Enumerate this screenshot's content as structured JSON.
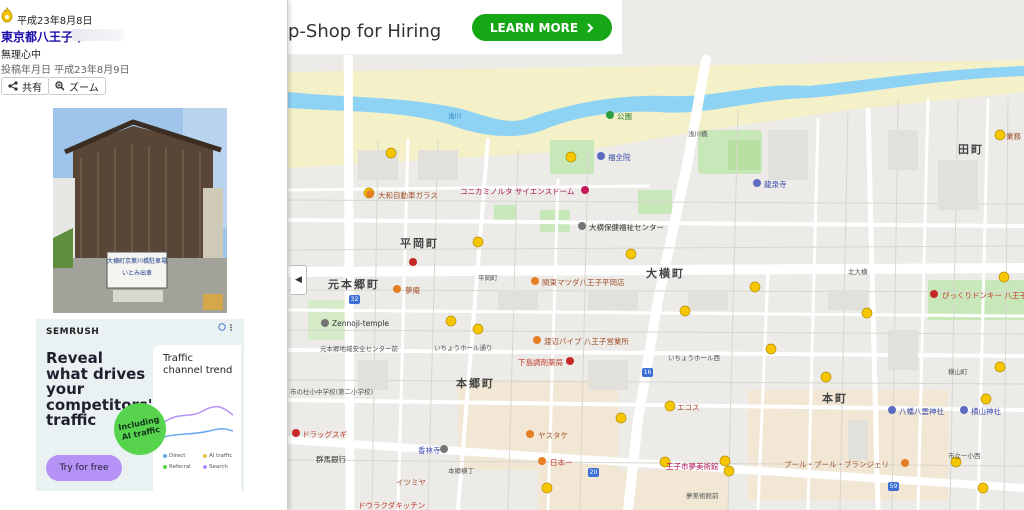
{
  "panel": {
    "date_top": "平成23年8月8日",
    "place_title": "東京都八王子市:",
    "place_note": "無理心中",
    "post_dates": "投稿年月日 平成23年8月9日",
    "share_label": "共有",
    "zoom_label": "ズーム",
    "photo_sign": "大横町京葉川橋駐車場",
    "photo_sign_sub": "いとみ出車"
  },
  "side_ad": {
    "brand": "SEMRUSH",
    "headline": "Reveal what drives your competitors' traffic",
    "card_title": "Traffic channel trend",
    "badge": "Including AI traffic",
    "cta": "Try for free",
    "legend": [
      "Direct",
      "AI traffic",
      "Referral",
      "Search"
    ]
  },
  "top_ad": {
    "text": "p-Shop for Hiring",
    "button": "LEARN MORE"
  },
  "map": {
    "river": "浅川",
    "districts": [
      "平岡町",
      "元本郷町",
      "大横町",
      "本郷町",
      "本町",
      "田町"
    ],
    "pois": {
      "park": "公園",
      "fukuzen": "福全院",
      "ryusenji": "龍泉寺",
      "konica": "コニカミノルタ サイエンスドーム",
      "daiwa": "大和自動車ガラス",
      "ohyoko_center": "大横保健福祉センター",
      "kanto_mazda": "関東マツダ八王子平岡店",
      "yumean": "夢庵",
      "zennoji": "Zennoji-temple",
      "watanabe": "渡辺パイプ 八王子営業所",
      "shimomura": "下島調剤薬局",
      "ecos": "エコス",
      "drug": "ドラッグスギ",
      "kourinji": "香林寺",
      "yasutake": "ヤスタケ",
      "nihonichi": "日本一",
      "gunma": "群馬銀行",
      "yumebi": "王子市夢美術館",
      "pool": "プール・プール・ブランジェリ",
      "hachiman": "八幡八雲神社",
      "yokoyama": "横山神社",
      "itoyoka": "イツミヤ",
      "donki": "びっくりドンキー 八王子",
      "dorakura": "ドウラクダキッチン",
      "gyomu": "業務"
    },
    "roads": {
      "north_ohyoko": "北大横",
      "ichou": "いちょうホール通り",
      "ichou_west": "いちょうホール西",
      "hirakado": "平岡町",
      "motohongo_center": "元本郷地域安全センター前",
      "school": "市の杜小中学校(第二小学校)",
      "hongo4": "本郷横丁",
      "hachiman_st": "八幡八雲通り",
      "bridge": "浅川橋",
      "yumebi_front": "夢美術館前",
      "ichigo": "市立一小西",
      "yokoyama_st": "横山町"
    },
    "shields": [
      "32",
      "16",
      "20",
      "59"
    ],
    "collapse_icon": "chevron-left-icon"
  }
}
